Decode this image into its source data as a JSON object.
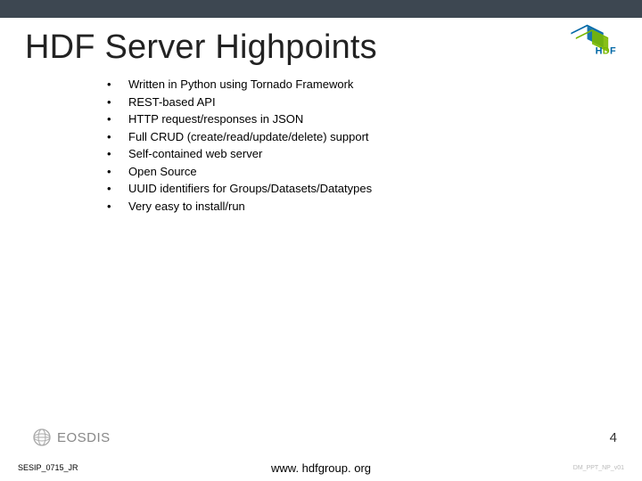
{
  "title": "HDF Server Highpoints",
  "logo_alt": "hdf-logo",
  "bullets": [
    "Written in Python using Tornado Framework",
    "REST-based API",
    "HTTP request/responses in JSON",
    "Full CRUD (create/read/update/delete) support",
    "Self-contained web server",
    "Open Source",
    "UUID identifiers for Groups/Datasets/Datatypes",
    "Very easy to install/run"
  ],
  "footer": {
    "eosdis_label": "EOSDIS",
    "page_number": "4",
    "sesip": "SESIP_0715_JR",
    "website": "www. hdfgroup. org",
    "dmref": "DM_PPT_NP_v01"
  }
}
